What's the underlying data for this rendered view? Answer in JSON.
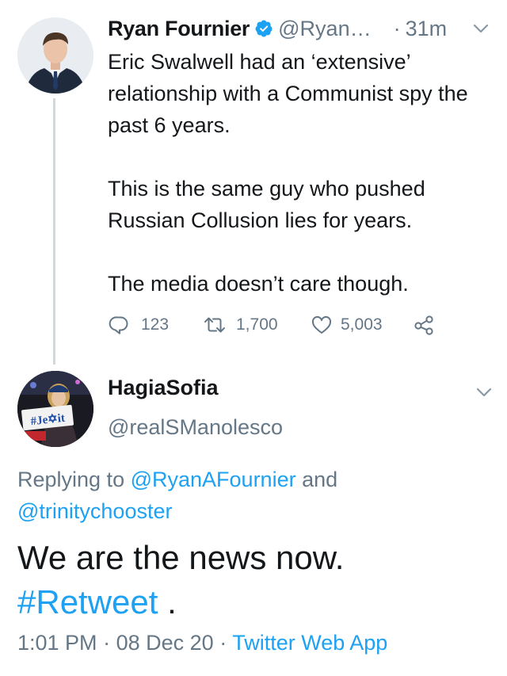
{
  "parent_tweet": {
    "author_name": "Ryan Fournier",
    "handle": "@Ryan…",
    "time": "31m",
    "text_lines": [
      "Eric Swalwell had an ‘extensive’ relationship with a Communist spy the past 6 years.",
      "This is the same guy who pushed Russian Collusion lies for years.",
      "The media doesn’t care though."
    ],
    "stats": {
      "replies": "123",
      "retweets": "1,700",
      "likes": "5,003"
    }
  },
  "reply_tweet": {
    "author_name": "HagiaSofia",
    "handle": "@realSManolesco",
    "avatar_sign_text": "#Jexit",
    "replying_prefix": "Replying to ",
    "replying_mention_1": "@RyanAFournier",
    "replying_and": " and ",
    "replying_mention_2": "@trinitychooster",
    "text": "We are the news now.",
    "hashtag": "#Retweet",
    "text_suffix": " .",
    "time": "1:01 PM",
    "date": "08 Dec 20",
    "source": "Twitter Web App",
    "separator": "·"
  },
  "colors": {
    "link_blue": "#1da1f2",
    "secondary_gray": "#657786",
    "primary_text": "#14171a",
    "thread_line": "#cfd9de"
  }
}
